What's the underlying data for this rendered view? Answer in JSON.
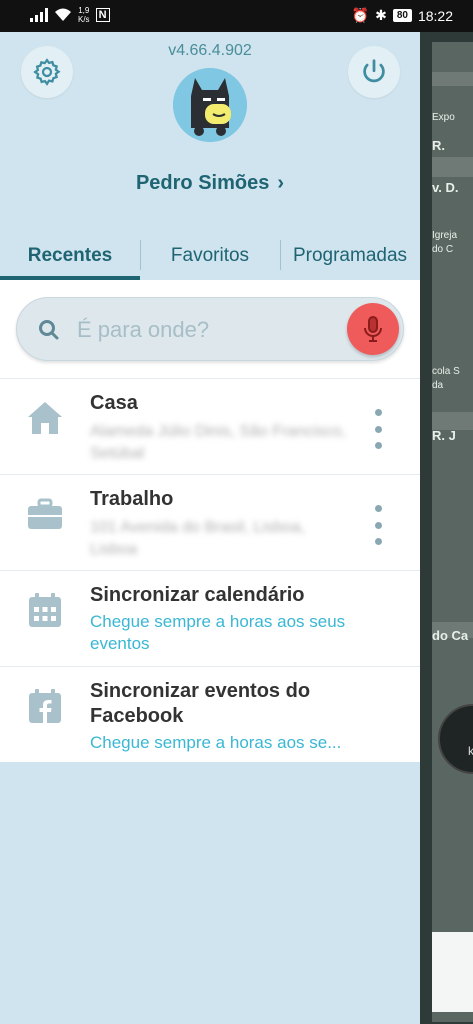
{
  "statusbar": {
    "network_speed_top": "1,9",
    "network_speed_bottom": "K/s",
    "nfc": "N",
    "battery": "80",
    "time": "18:22"
  },
  "header": {
    "version": "v4.66.4.902",
    "username": "Pedro Simões"
  },
  "tabs": [
    {
      "label": "Recentes",
      "active": true
    },
    {
      "label": "Favoritos",
      "active": false
    },
    {
      "label": "Programadas",
      "active": false
    }
  ],
  "search": {
    "placeholder": "É para onde?"
  },
  "items": [
    {
      "title": "Casa",
      "address": "Alameda Júlio Dinis, São Francisco, Setúbal",
      "icon": "home-icon"
    },
    {
      "title": "Trabalho",
      "address": "101 Avenida do Brasil, Lisboa, Lisboa",
      "icon": "briefcase-icon"
    },
    {
      "title": "Sincronizar calendário",
      "subtitle": "Chegue sempre a horas aos seus eventos",
      "icon": "calendar-icon"
    },
    {
      "title": "Sincronizar eventos do Facebook",
      "subtitle": "Chegue sempre a horas aos se...",
      "icon": "facebook-calendar-icon"
    }
  ],
  "map": {
    "labels": [
      "Expo",
      "R.",
      "v. D.",
      "Igreja",
      "do C",
      "cola S",
      "da",
      "R. J",
      "do Ca",
      "k"
    ]
  },
  "colors": {
    "drawer_bg": "#cfe4ee",
    "accent": "#1f6473",
    "link": "#3ab7d4",
    "mic": "#ef5a5a"
  }
}
